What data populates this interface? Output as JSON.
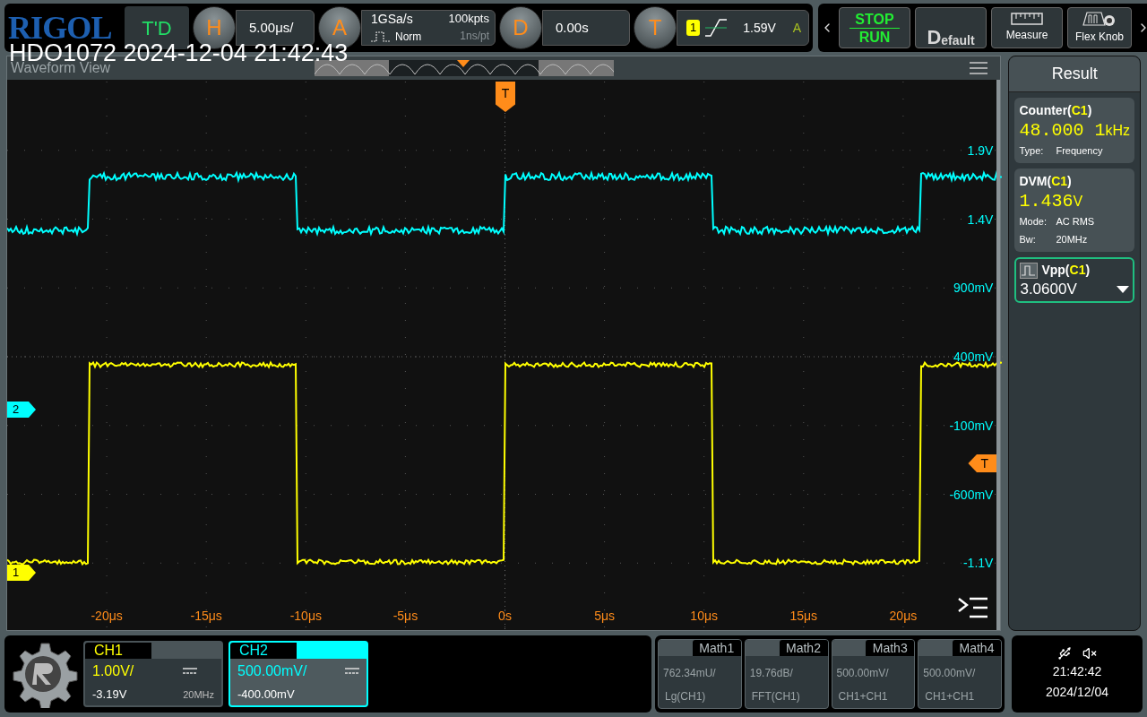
{
  "top_bar": {
    "logo": "RIGOL",
    "time_delay": "T'D",
    "horizontal": {
      "key": "H",
      "scale": "5.00μs/"
    },
    "acquire": {
      "key": "A",
      "rate": "1GSa/s",
      "mode": "Norm",
      "depth": "100kpts",
      "resolution": "1ns/pt"
    },
    "delay": {
      "key": "D",
      "value": "0.00s"
    },
    "trigger": {
      "key": "T",
      "source": "1",
      "level": "1.59V",
      "sweep": "A"
    },
    "buttons": [
      {
        "kind": "stop_run",
        "top": "STOP",
        "bottom": "RUN"
      },
      {
        "kind": "default",
        "initial": "D",
        "rest": "efault"
      },
      {
        "kind": "measure",
        "label": "Measure"
      },
      {
        "kind": "flex_knob",
        "label": "Flex Knob"
      }
    ]
  },
  "overlay_title": "HDO1072 2024-12-04 21:42:43",
  "waveform_view": {
    "title": "Waveform View",
    "trigger_position_marker": "T",
    "trigger_level_marker": "T",
    "y_labels": [
      "1.9V",
      "1.4V",
      "900mV",
      "400mV",
      "-100mV",
      "-600mV",
      "-1.1V"
    ],
    "x_labels": [
      "-20μs",
      "-15μs",
      "-10μs",
      "-5μs",
      "0s",
      "5μs",
      "10μs",
      "15μs",
      "20μs"
    ],
    "channel_markers": [
      {
        "label": "2"
      },
      {
        "label": "1"
      }
    ]
  },
  "result": {
    "title": "Result",
    "items": [
      {
        "kind": "counter",
        "name": "Counter(",
        "source": "C1",
        "suffix": ")",
        "value": "48.000 1",
        "unit": "kHz",
        "details": [
          {
            "label": "Type:",
            "value": "Frequency"
          }
        ]
      },
      {
        "kind": "dvm",
        "name": "DVM(",
        "source": "C1",
        "suffix": ")",
        "value": "1.436",
        "unit": "V",
        "details": [
          {
            "label": "Mode:",
            "value": "AC RMS"
          },
          {
            "label": "Bw:",
            "value": "20MHz"
          }
        ]
      },
      {
        "kind": "measure",
        "name": "Vpp(",
        "source": "C1",
        "suffix": ")",
        "value": "3.0600V",
        "selected": true
      }
    ]
  },
  "channels": [
    {
      "name": "CH1",
      "scale": "1.00V/",
      "offset": "-3.19V",
      "bandwidth": "20MHz",
      "selected": false,
      "color": "#ffff00"
    },
    {
      "name": "CH2",
      "scale": "500.00mV/",
      "offset": "-400.00mV",
      "selected": true,
      "color": "#00ffff"
    }
  ],
  "math": [
    {
      "name": "Math1",
      "scale": "762.34mU/",
      "source": "Lg(CH1)"
    },
    {
      "name": "Math2",
      "scale": "19.76dB/",
      "source": "FFT(CH1)"
    },
    {
      "name": "Math3",
      "scale": "500.00mV/",
      "source": "CH1+CH1"
    },
    {
      "name": "Math4",
      "scale": "500.00mV/",
      "source": "CH1+CH1"
    }
  ],
  "status": {
    "time": "21:42:42",
    "date": "2024/12/04"
  }
}
